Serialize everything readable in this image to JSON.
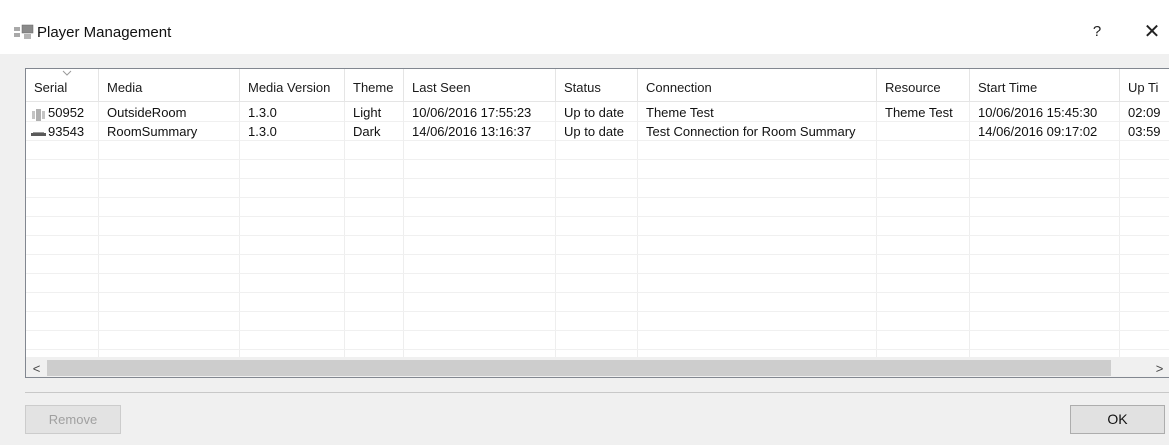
{
  "window": {
    "title": "Player Management",
    "icon": "player-management-icon",
    "help_label": "?",
    "close_label": "✕"
  },
  "table": {
    "columns": [
      "Serial",
      "Media",
      "Media Version",
      "Theme",
      "Last Seen",
      "Status",
      "Connection",
      "Resource",
      "Start Time",
      "Up Ti"
    ],
    "sorted_column": "Serial",
    "rows": [
      {
        "icon": "player-device-icon",
        "cells": [
          "50952",
          "OutsideRoom",
          "1.3.0",
          "Light",
          "10/06/2016 17:55:23",
          "Up to date",
          "Theme Test",
          "Theme Test",
          "10/06/2016 15:45:30",
          "02:09"
        ]
      },
      {
        "icon": "player-device-flat-icon",
        "cells": [
          "93543",
          "RoomSummary",
          "1.3.0",
          "Dark",
          "14/06/2016 13:16:37",
          "Up to date",
          "Test Connection for Room Summary",
          "",
          "14/06/2016 09:17:02",
          "03:59"
        ]
      }
    ]
  },
  "scrollbar": {
    "left_arrow": "<",
    "right_arrow": ">"
  },
  "buttons": {
    "remove_label": "Remove",
    "ok_label": "OK"
  },
  "colors": {
    "window_bg": "#f0f0f0",
    "list_bg": "#ffffff",
    "border": "#828790",
    "disabled_text": "#a0a0a0"
  }
}
